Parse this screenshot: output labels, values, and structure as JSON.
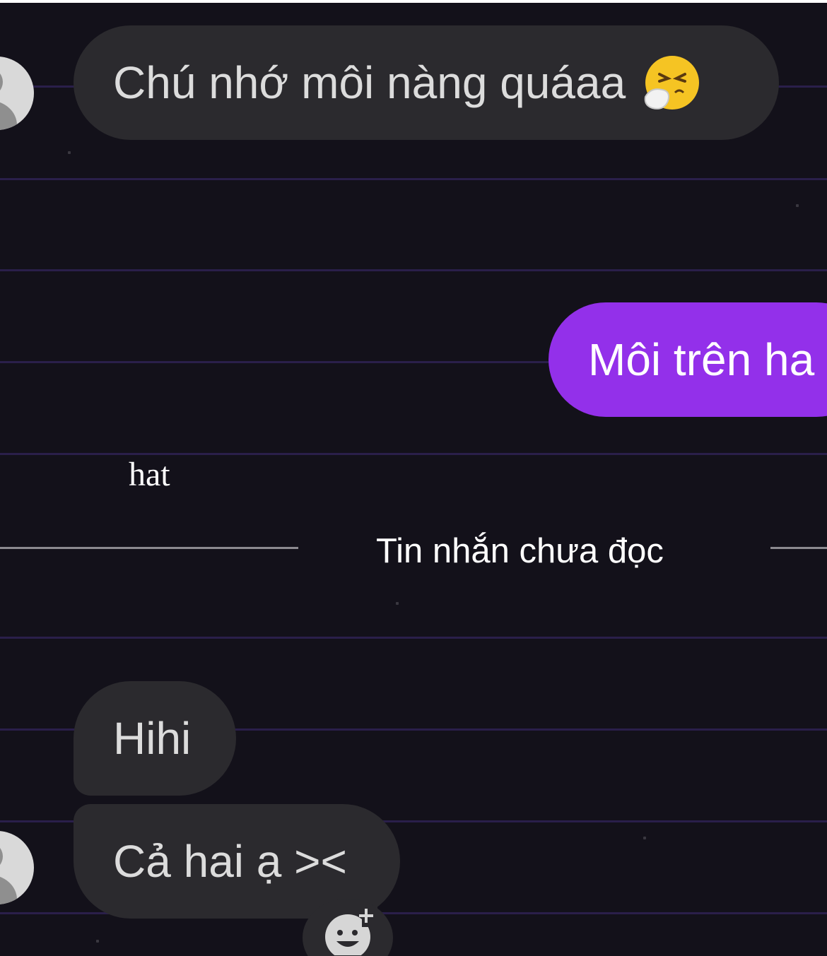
{
  "messages": [
    {
      "direction": "incoming",
      "text": "Chú nhớ môi nàng quáaa",
      "emoji": "sneezing-face-icon"
    },
    {
      "direction": "outgoing",
      "text": "Môi trên ha"
    },
    {
      "direction": "incoming",
      "text": "Hihi"
    },
    {
      "direction": "incoming",
      "text": "Cả hai ạ ><"
    }
  ],
  "caption": "hat",
  "divider": {
    "label": "Tin nhắn chưa đọc"
  },
  "reaction_button": {
    "icon": "add-reaction-icon"
  },
  "colors": {
    "background": "#13111a",
    "incoming_bubble": "#2b2a2e",
    "outgoing_bubble": "#9330ea",
    "ruled_lines": "#2a1f4a"
  }
}
